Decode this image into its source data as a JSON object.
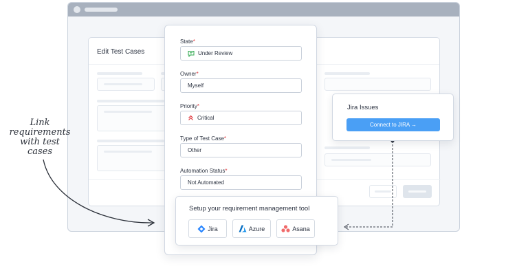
{
  "edit_card": {
    "title": "Edit Test Cases"
  },
  "form": {
    "state": {
      "label": "State",
      "value": "Under Review",
      "icon": "chat-bubble-icon",
      "icon_color": "#2fa84f"
    },
    "owner": {
      "label": "Owner",
      "value": "Myself"
    },
    "priority": {
      "label": "Priority",
      "value": "Critical",
      "icon": "double-chevron-up-icon",
      "icon_color": "#e0393e"
    },
    "type": {
      "label": "Type of Test Case",
      "value": "Other"
    },
    "automation": {
      "label": "Automation Status",
      "value": "Not Automated"
    },
    "required_marker": "*"
  },
  "setup": {
    "title": "Setup your requirement management tool",
    "tools": [
      {
        "label": "Jira",
        "icon": "jira-logo-icon",
        "color": "#2684ff"
      },
      {
        "label": "Azure",
        "icon": "azure-logo-icon",
        "color": "#0a6fc2"
      },
      {
        "label": "Asana",
        "icon": "asana-logo-icon",
        "color": "#f06a6a"
      }
    ]
  },
  "jira": {
    "title": "Jira Issues",
    "button_label": "Connect to JIRA →",
    "accent": "#4a9ff5"
  },
  "annotation": {
    "lines": [
      "Link",
      "requirements",
      "with test",
      "cases"
    ]
  }
}
